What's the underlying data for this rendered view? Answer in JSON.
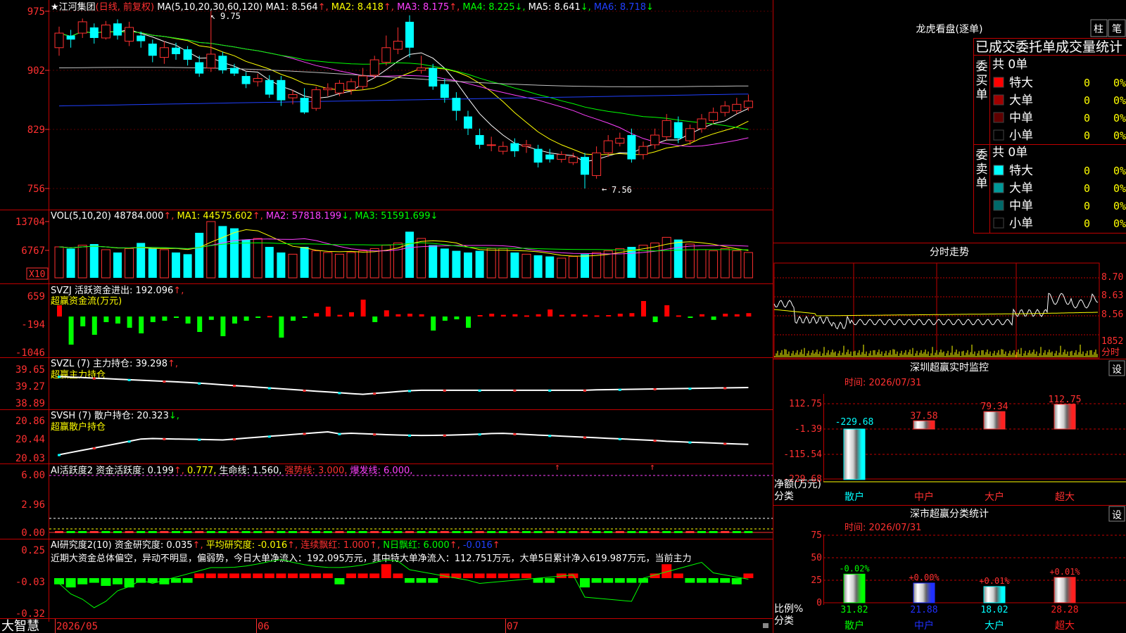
{
  "chart": {
    "price_ticks": [
      "975",
      "902",
      "829",
      "756"
    ],
    "vol_ticks": [
      "13704",
      "6767"
    ],
    "vol_unit": "X10",
    "flow_ticks": [
      "659",
      "-194",
      "-1046"
    ],
    "hold_ticks": [
      "39.65",
      "39.27",
      "38.89"
    ],
    "retail_ticks": [
      "20.86",
      "20.44",
      "20.03"
    ],
    "ai_ticks": [
      "6.00",
      "2.96",
      "0.00"
    ],
    "study_ticks": [
      "0.25",
      "-0.03",
      "-0.32"
    ],
    "x_labels": [
      "2026/05",
      "06",
      "07"
    ],
    "high_annot": "9.75",
    "low_annot": "7.56"
  },
  "main_legend": [
    {
      "t": "★江河集团",
      "c": "#ffffff"
    },
    {
      "t": "(日线, 前复权)",
      "c": "#ff3030"
    },
    {
      "t": " MA(5,10,20,30,60,120) ",
      "c": "#ffffff"
    },
    {
      "t": "MA1: 8.564",
      "c": "#ffffff"
    },
    {
      "t": "↑, ",
      "c": "#ff3030"
    },
    {
      "t": "MA2: 8.418",
      "c": "#ffff00"
    },
    {
      "t": "↑, ",
      "c": "#ff3030"
    },
    {
      "t": "MA3: 8.175",
      "c": "#ff40ff"
    },
    {
      "t": "↑, ",
      "c": "#ff3030"
    },
    {
      "t": "MA4: 8.225",
      "c": "#00ff00"
    },
    {
      "t": "↓, ",
      "c": "#00ff00"
    },
    {
      "t": "MA5: 8.641",
      "c": "#ffffff"
    },
    {
      "t": "↓, ",
      "c": "#00ff00"
    },
    {
      "t": "MA6: 8.718",
      "c": "#2040ff"
    },
    {
      "t": "↓",
      "c": "#00ff00"
    }
  ],
  "vol_legend": [
    {
      "t": "VOL(5,10,20) ",
      "c": "#ffffff"
    },
    {
      "t": "48784.000",
      "c": "#ffffff"
    },
    {
      "t": "↑, ",
      "c": "#ff3030"
    },
    {
      "t": "MA1: 44575.602",
      "c": "#ffff00"
    },
    {
      "t": "↑, ",
      "c": "#ff3030"
    },
    {
      "t": "MA2: 57818.199",
      "c": "#ff40ff"
    },
    {
      "t": "↓, ",
      "c": "#00ff00"
    },
    {
      "t": "MA3: 51591.699",
      "c": "#00ff00"
    },
    {
      "t": "↓",
      "c": "#00ff00"
    }
  ],
  "flow_legend": [
    {
      "t": "SVZJ  活跃资金进出: 192.096",
      "c": "#ffffff"
    },
    {
      "t": "↑, ",
      "c": "#ff3030"
    }
  ],
  "flow_sub": "超赢资金流(万元)",
  "hold_legend": [
    {
      "t": "SVZL (7) 主力持仓: 39.298",
      "c": "#ffffff"
    },
    {
      "t": "↑, ",
      "c": "#ff3030"
    }
  ],
  "hold_sub": "超赢主力持仓",
  "retail_legend": [
    {
      "t": "SVSH (7) 散户持仓: 20.323",
      "c": "#ffffff"
    },
    {
      "t": "↓, ",
      "c": "#00ff00"
    }
  ],
  "retail_sub": "超赢散户持仓",
  "ai_legend": [
    {
      "t": "AI活跃度2 资金活跃度: 0.199",
      "c": "#ffffff"
    },
    {
      "t": "↑, ",
      "c": "#ff3030"
    },
    {
      "t": "0.777, ",
      "c": "#ffff00"
    },
    {
      "t": "生命线: 1.560, ",
      "c": "#ffffff"
    },
    {
      "t": "强势线: 3.000, ",
      "c": "#ff3030"
    },
    {
      "t": "爆发线: 6.000, ",
      "c": "#ff40ff"
    }
  ],
  "study_legend": [
    {
      "t": "AI研究度2(10) 资金研究度: 0.035",
      "c": "#ffffff"
    },
    {
      "t": "↑, ",
      "c": "#ff3030"
    },
    {
      "t": "平均研究度: -0.016",
      "c": "#ffff00"
    },
    {
      "t": "↑, ",
      "c": "#ff3030"
    },
    {
      "t": "连续飘红: 1.000",
      "c": "#ff3030"
    },
    {
      "t": "↑, ",
      "c": "#ff3030"
    },
    {
      "t": "N日飘红: 6.000",
      "c": "#00ff00"
    },
    {
      "t": "↑, ",
      "c": "#ff3030"
    },
    {
      "t": "-0.016",
      "c": "#2040ff"
    },
    {
      "t": "↑",
      "c": "#ff3030"
    }
  ],
  "study_comment": "近期大资金总体偏空，异动不明显，偏弱势，今日大单净流入：192.095万元，其中特大单净流入：112.751万元，大单5日累计净入619.987万元，当前主力",
  "brand": "大智慧",
  "right": {
    "dragon_title": "龙虎看盘(逐单)",
    "btn_zhu": "柱",
    "btn_bi": "笔",
    "order_stats_title": "已成交委托单成交量统计",
    "buy_side": "委买单",
    "sell_side": "委卖单",
    "buy_total": "共 0单",
    "sell_total": "共 0单",
    "buy_rows": [
      {
        "label": "特大",
        "count": "0",
        "pct": "0%",
        "color": "#ff0000"
      },
      {
        "label": "大单",
        "count": "0",
        "pct": "0%",
        "color": "#a00000"
      },
      {
        "label": "中单",
        "count": "0",
        "pct": "0%",
        "color": "#600000"
      },
      {
        "label": "小单",
        "count": "0",
        "pct": "0%",
        "color": "#000000"
      }
    ],
    "sell_rows": [
      {
        "label": "特大",
        "count": "0",
        "pct": "0%",
        "color": "#00ffff"
      },
      {
        "label": "大单",
        "count": "0",
        "pct": "0%",
        "color": "#009a9a"
      },
      {
        "label": "中单",
        "count": "0",
        "pct": "0%",
        "color": "#006a6a"
      },
      {
        "label": "小单",
        "count": "0",
        "pct": "0%",
        "color": "#000000"
      }
    ],
    "intraday_title": "分时走势",
    "intraday_ticks": [
      "8.70",
      "8.63",
      "8.56"
    ],
    "intraday_vol": "1852",
    "intraday_unit": "分时",
    "monitor_title": "深圳超赢实时监控",
    "settings_btn": "设",
    "monitor_time": "时间: 2026/07/31",
    "monitor_ticks": [
      "112.75",
      "-1.39",
      "-115.54",
      "-229.68"
    ],
    "monitor_ylabel": "净额(万元)",
    "monitor_xlabel": "分类",
    "monitor_cats": [
      "散户",
      "中户",
      "大户",
      "超大"
    ],
    "monitor_values": [
      -229.68,
      37.58,
      79.34,
      112.75
    ],
    "monitor_value_labels": [
      "-229.68",
      "37.58",
      "79.34",
      "112.75"
    ],
    "class_title": "深市超赢分类统计",
    "class_time": "时间: 2026/07/31",
    "class_ticks": [
      "75",
      "50",
      "25",
      "0"
    ],
    "class_ylabel": "比例%",
    "class_xlabel": "分类",
    "class_cats": [
      "散户",
      "中户",
      "大户",
      "超大"
    ],
    "class_values": [
      31.82,
      21.88,
      18.02,
      28.28
    ],
    "class_changes": [
      "-0.02%",
      "+0.00%",
      "+0.01%",
      "+0.01%"
    ],
    "class_colors": [
      "#00ff00",
      "#2030ff",
      "#00ffff",
      "#ff2020"
    ]
  }
}
